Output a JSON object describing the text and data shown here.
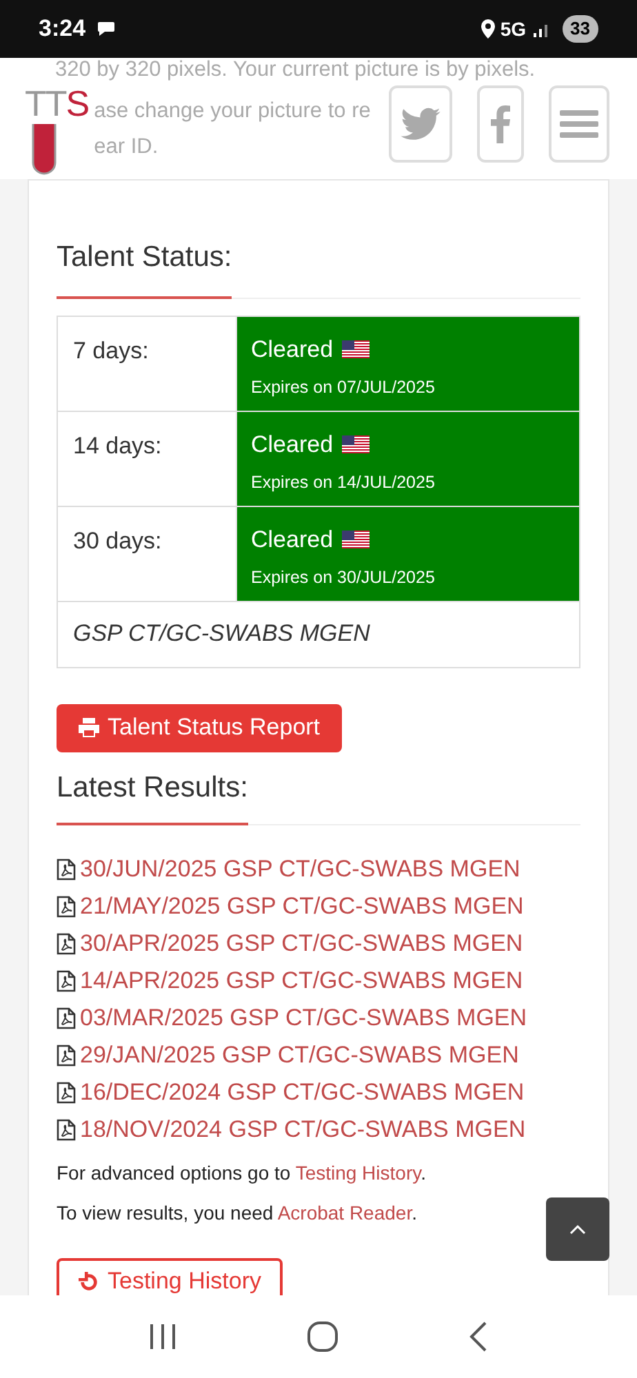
{
  "status_bar": {
    "time": "3:24",
    "network": "5G",
    "battery": "33"
  },
  "notice": {
    "lines": [
      "320 by 320 pixels. Your current picture is by pixels.",
      "ase change your picture to re",
      "ear ID."
    ]
  },
  "header": {
    "logo": "TTS"
  },
  "talent_status": {
    "title": "Talent Status:",
    "rows": [
      {
        "period": "7 days:",
        "status": "Cleared",
        "expires": "Expires on 07/JUL/2025",
        "cleared": true
      },
      {
        "period": "14 days:",
        "status": "Cleared",
        "expires": "Expires on 14/JUL/2025",
        "cleared": true
      },
      {
        "period": "30 days:",
        "status": "Cleared",
        "expires": "Expires on 30/JUL/2025",
        "cleared": true
      }
    ],
    "footer": "GSP CT/GC-SWABS MGEN"
  },
  "report_button": "Talent Status Report",
  "latest_results": {
    "title": "Latest Results:",
    "items": [
      "30/JUN/2025 GSP CT/GC-SWABS MGEN",
      "21/MAY/2025 GSP CT/GC-SWABS MGEN",
      "30/APR/2025 GSP CT/GC-SWABS MGEN",
      "14/APR/2025 GSP CT/GC-SWABS MGEN",
      "03/MAR/2025 GSP CT/GC-SWABS MGEN",
      "29/JAN/2025 GSP CT/GC-SWABS MGEN",
      "16/DEC/2024 GSP CT/GC-SWABS MGEN",
      "18/NOV/2024 GSP CT/GC-SWABS MGEN"
    ]
  },
  "notes": [
    {
      "text": "For advanced options go to ",
      "link": "Testing History",
      "end": "."
    },
    {
      "text": "To view results, you need ",
      "link": "Acrobat Reader",
      "end": "."
    }
  ],
  "history_button": "Testing History"
}
